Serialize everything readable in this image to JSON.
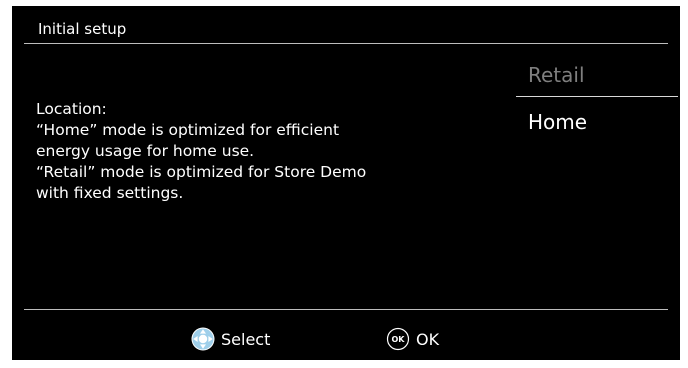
{
  "header": {
    "title": "Initial setup"
  },
  "description": {
    "lines": [
      "Location:",
      "“Home” mode is optimized for efficient",
      "energy usage for home use.",
      "“Retail” mode is optimized for Store Demo",
      "with fixed settings."
    ]
  },
  "menu": {
    "items": [
      {
        "label": "Retail",
        "state": "dim"
      },
      {
        "label": "Home",
        "state": "selected"
      }
    ]
  },
  "footer": {
    "select_label": "Select",
    "select_icon": "navigation-pad-icon",
    "ok_label": "OK",
    "ok_icon": "ok-button-icon",
    "ok_icon_text": "OK"
  },
  "colors": {
    "background": "#000000",
    "text": "#ffffff",
    "dim_text": "#7f7f7f",
    "divider": "#bdbdbd"
  }
}
